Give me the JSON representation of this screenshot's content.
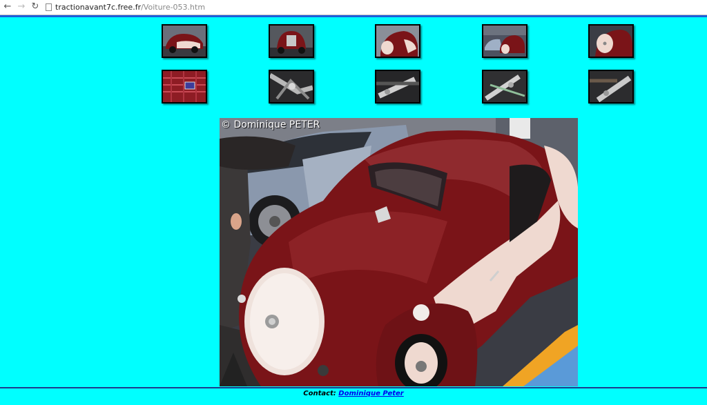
{
  "browser": {
    "url_host": "tractionavant7c.free.fr",
    "url_path": "/Voiture-053.htm"
  },
  "thumbnails": [
    {
      "name": "thumb-1",
      "subject": "red and cream coupe, front view"
    },
    {
      "name": "thumb-2",
      "subject": "coupe front grille"
    },
    {
      "name": "thumb-3",
      "subject": "coupe rear with spare wheel"
    },
    {
      "name": "thumb-4",
      "subject": "coupe in hall"
    },
    {
      "name": "thumb-5",
      "subject": "spare wheel cover"
    },
    {
      "name": "thumb-6",
      "subject": "rear license plate"
    },
    {
      "name": "thumb-7",
      "subject": "undercarriage detail"
    },
    {
      "name": "thumb-8",
      "subject": "suspension detail"
    },
    {
      "name": "thumb-9",
      "subject": "exhaust detail"
    },
    {
      "name": "thumb-10",
      "subject": "chassis detail"
    }
  ],
  "photo": {
    "credit": "© Dominique PETER"
  },
  "footer": {
    "contact_label": "Contact:",
    "contact_link": "Dominique Peter"
  },
  "colors": {
    "page_background": "#00ffff",
    "car_body": "#7a1418",
    "car_cream": "#efd9d0",
    "link": "#0000ee"
  }
}
